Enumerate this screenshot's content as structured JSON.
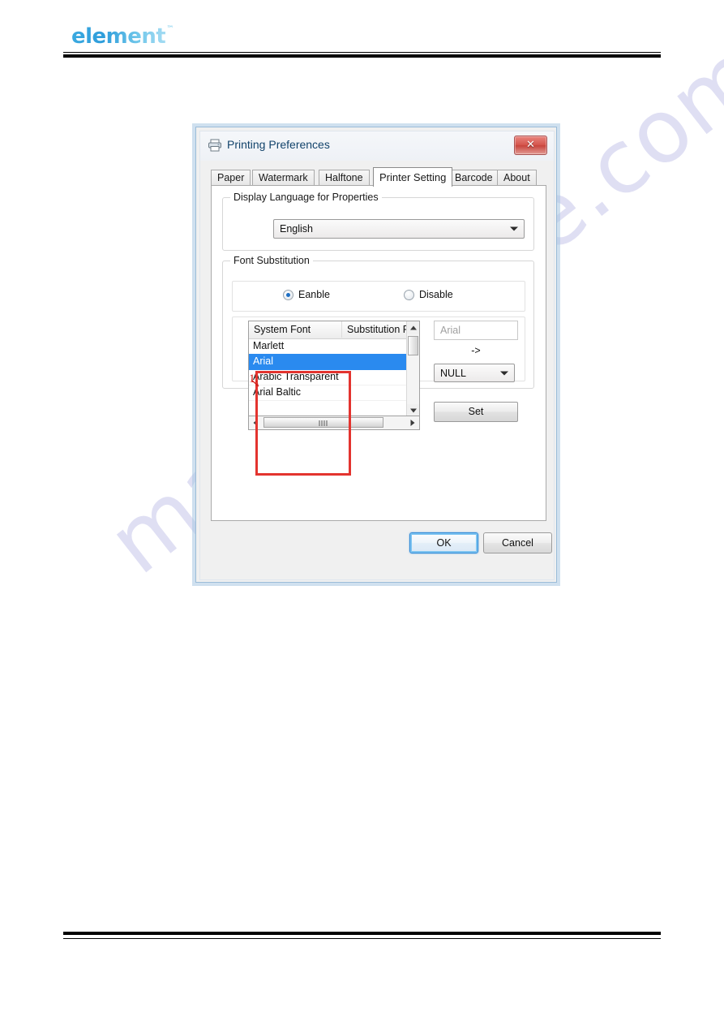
{
  "page": {
    "logo_text": "element",
    "logo_tm": "™",
    "watermark": "manualshive.com"
  },
  "dialog": {
    "title": "Printing Preferences",
    "printer_icon": "printer-icon",
    "close_label": "✕",
    "tabs": [
      {
        "label": "Paper",
        "active": false
      },
      {
        "label": "Watermark",
        "active": false
      },
      {
        "label": "Halftone",
        "active": false
      },
      {
        "label": "Printer Setting",
        "active": true
      },
      {
        "label": "Barcode",
        "active": false
      },
      {
        "label": "About",
        "active": false
      }
    ],
    "language_group": {
      "title": "Display Language for Properties",
      "combo_value": "English"
    },
    "font_substitution_group": {
      "title": "Font Substitution",
      "radios": [
        {
          "label": "Eanble",
          "checked": true
        },
        {
          "label": "Disable",
          "checked": false
        }
      ],
      "listview": {
        "columns": [
          "System Font",
          "Substitution Font"
        ],
        "rows": [
          {
            "system_font": "Marlett",
            "substitution_font": "",
            "selected": false
          },
          {
            "system_font": "Arial",
            "substitution_font": "",
            "selected": true
          },
          {
            "system_font": "Arabic Transparent",
            "substitution_font": "",
            "selected": false
          },
          {
            "system_font": "Arial Baltic",
            "substitution_font": "",
            "selected": false
          }
        ]
      },
      "selected_font_value": "Arial",
      "arrow_label": "->",
      "substitution_combo_value": "NULL",
      "set_button_label": "Set"
    },
    "annotation": {
      "number": "1.",
      "highlight_color": "#e3342f"
    },
    "footer": {
      "ok_label": "OK",
      "cancel_label": "Cancel"
    }
  }
}
